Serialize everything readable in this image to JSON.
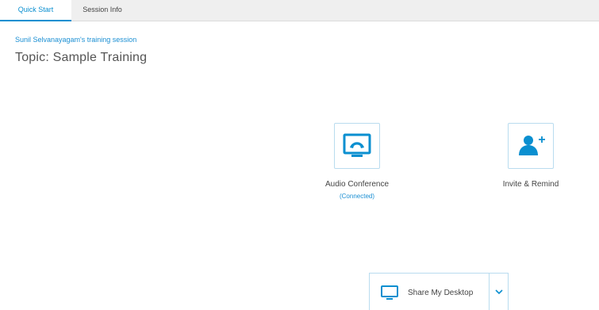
{
  "tabs": [
    {
      "label": "Quick Start",
      "active": true
    },
    {
      "label": "Session Info",
      "active": false
    }
  ],
  "session": {
    "host": "Sunil Selvanayagam's training session",
    "topic": "Topic: Sample Training"
  },
  "actions": {
    "audio": {
      "label": "Audio Conference",
      "status": "(Connected)",
      "icon": "audio-conference-icon"
    },
    "invite": {
      "label": "Invite & Remind",
      "icon": "add-person-icon"
    },
    "share": {
      "label": "Share My Desktop",
      "icon": "monitor-icon",
      "dropdown_icon": "chevron-down-icon"
    }
  },
  "colors": {
    "accent": "#0a8fd0",
    "tile_border": "#b9dcef",
    "text": "#444444",
    "tab_bar": "#efefef"
  }
}
